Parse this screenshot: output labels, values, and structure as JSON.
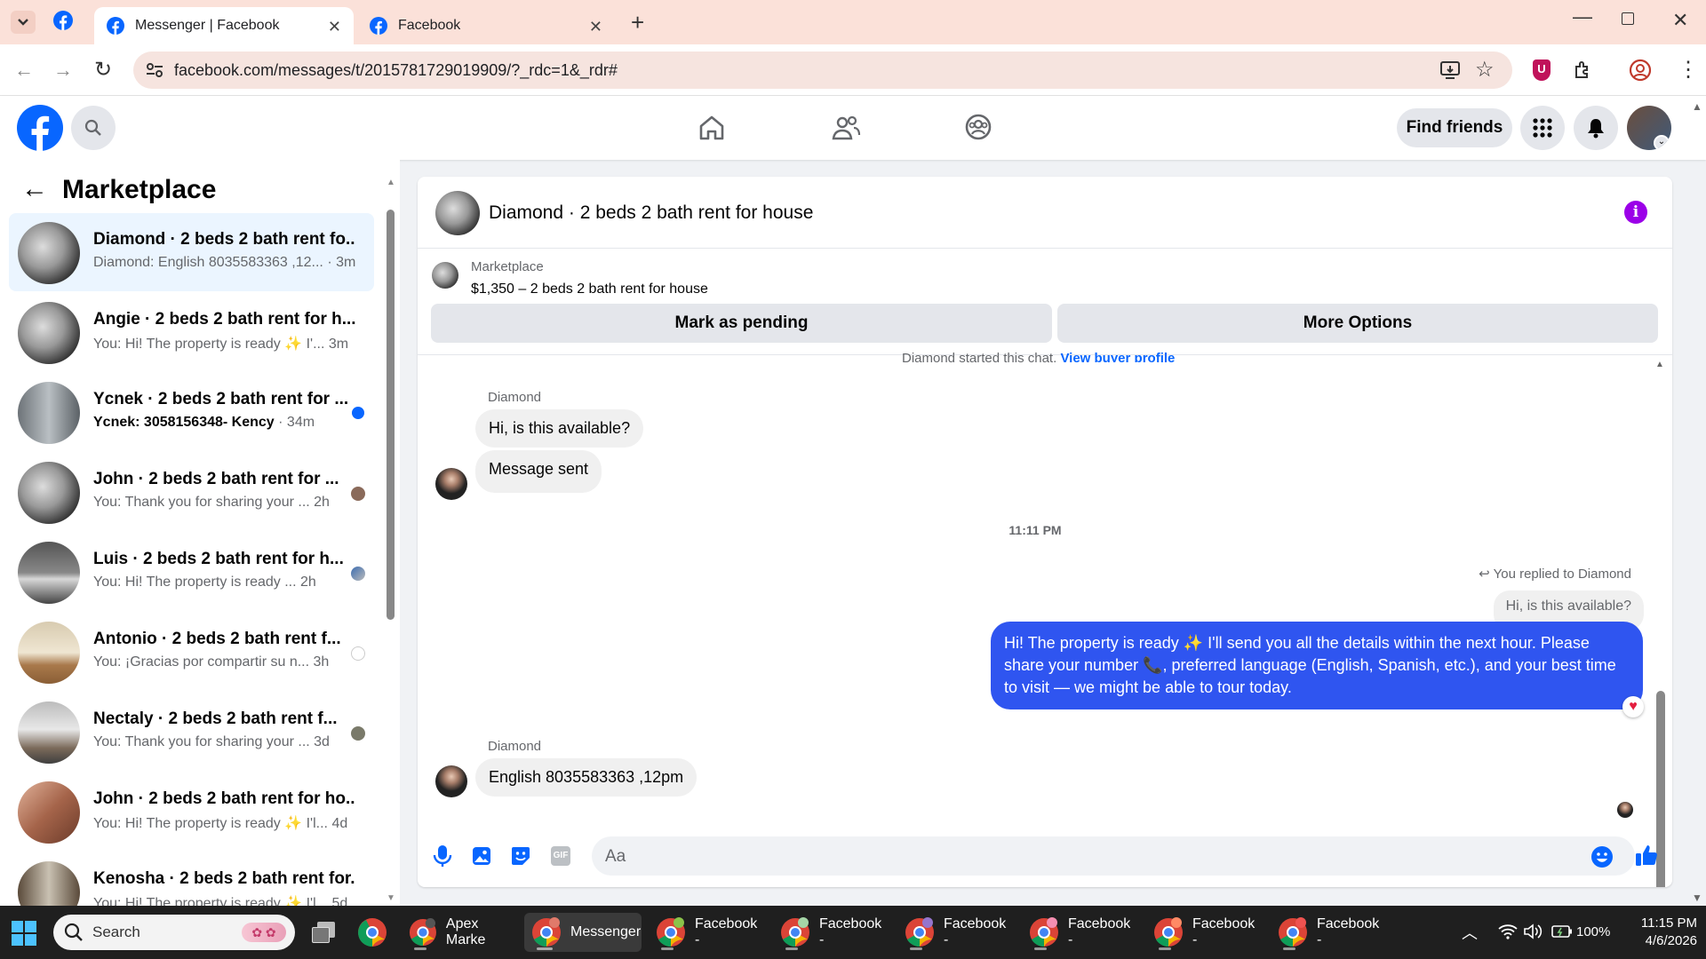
{
  "browser": {
    "tabs": [
      {
        "label": "Messenger | Facebook",
        "active": true
      },
      {
        "label": "Facebook",
        "active": false
      }
    ],
    "url": "facebook.com/messages/t/2015781729019909/?_rdc=1&_rdr#"
  },
  "header": {
    "find_friends": "Find friends"
  },
  "sidebar": {
    "title": "Marketplace",
    "conversations": [
      {
        "name": "Diamond · 2 beds 2 bath rent fo...",
        "preview": "Diamond: English 8035583363 ,12...",
        "time": "· 3m",
        "unread": false
      },
      {
        "name": "Angie · 2 beds 2 bath rent for h...",
        "preview": "You: Hi! The property is ready ✨ I'...",
        "time": "3m",
        "unread": false
      },
      {
        "name": "Ycnek · 2 beds 2 bath rent for ...",
        "preview": "Ycnek: 3058156348- Kency",
        "time": "· 34m",
        "unread": true
      },
      {
        "name": "John · 2 beds 2 bath rent for ...",
        "preview": "You: Thank you for sharing your ...",
        "time": "2h",
        "unread": false
      },
      {
        "name": "Luis · 2 beds 2 bath rent for h...",
        "preview": "You: Hi! The property is ready ...",
        "time": "2h",
        "unread": false
      },
      {
        "name": "Antonio · 2 beds 2 bath rent f...",
        "preview": "You: ¡Gracias por compartir su n...",
        "time": "3h",
        "unread": false
      },
      {
        "name": "Nectaly · 2 beds 2 bath rent f...",
        "preview": "You: Thank you for sharing your ...",
        "time": "3d",
        "unread": false
      },
      {
        "name": "John · 2 beds 2 bath rent for ho...",
        "preview": "You: Hi! The property is ready ✨ I'l...",
        "time": "4d",
        "unread": false
      },
      {
        "name": "Kenosha · 2 beds 2 bath rent for...",
        "preview": "You: Hi! The property is ready ✨ I'l...",
        "time": "5d",
        "unread": false
      }
    ]
  },
  "chat": {
    "title": "Diamond · 2 beds 2 bath rent for house",
    "listing_source": "Marketplace",
    "listing_title": "$1,350 – 2 beds 2 bath rent for house",
    "mark_pending": "Mark as pending",
    "more_options": "More Options",
    "started_text": "Diamond started this chat.",
    "view_profile": "View buyer profile",
    "sender_name": "Diamond",
    "msg1": "Hi, is this available?",
    "msg2": "Message sent",
    "timestamp": "11:11 PM",
    "replied_to": "You replied to Diamond",
    "quoted": "Hi, is this available?",
    "my_message": "Hi! The property is ready ✨ I'll send you all the details within the next hour. Please share your number 📞, preferred language (English, Spanish, etc.), and your best time to visit — we might be able to tour today.",
    "sender_name2": "Diamond",
    "msg3": "English 8035583363 ,12pm",
    "composer_placeholder": "Aa"
  },
  "taskbar": {
    "search": "Search",
    "apps": [
      {
        "label": "Apex Marke"
      },
      {
        "label": "Messenger"
      },
      {
        "label": "Facebook -"
      },
      {
        "label": "Facebook -"
      },
      {
        "label": "Facebook -"
      },
      {
        "label": "Facebook -"
      },
      {
        "label": "Facebook -"
      },
      {
        "label": "Facebook -"
      }
    ],
    "battery": "100%",
    "time": "11:15 PM",
    "date": "4/6/2026"
  },
  "colors": {
    "fb_blue": "#0866ff",
    "my_bubble": "#2f55f0",
    "tabbar": "#fbe1d9",
    "taskbar": "#1f1f1f"
  }
}
